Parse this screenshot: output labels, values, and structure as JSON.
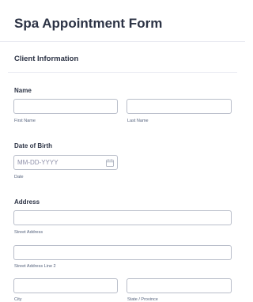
{
  "form": {
    "title": "Spa Appointment Form",
    "section_title": "Client Information",
    "name": {
      "label": "Name",
      "first_name": {
        "value": "",
        "sublabel": "First Name"
      },
      "last_name": {
        "value": "",
        "sublabel": "Last Name"
      }
    },
    "dob": {
      "label": "Date of Birth",
      "placeholder": "MM-DD-YYYY",
      "sublabel": "Date",
      "icon": "calendar-icon"
    },
    "address": {
      "label": "Address",
      "street": {
        "value": "",
        "sublabel": "Street Address"
      },
      "street2": {
        "value": "",
        "sublabel": "Street Address Line 2"
      },
      "city": {
        "value": "",
        "sublabel": "City"
      },
      "state": {
        "value": "",
        "sublabel": "State / Province"
      }
    }
  },
  "colors": {
    "text": "#2c3345",
    "sublabel": "#57647e",
    "input_border": "#b8bdc9",
    "placeholder": "#8d8fa8",
    "divider": "#eaebf2"
  }
}
